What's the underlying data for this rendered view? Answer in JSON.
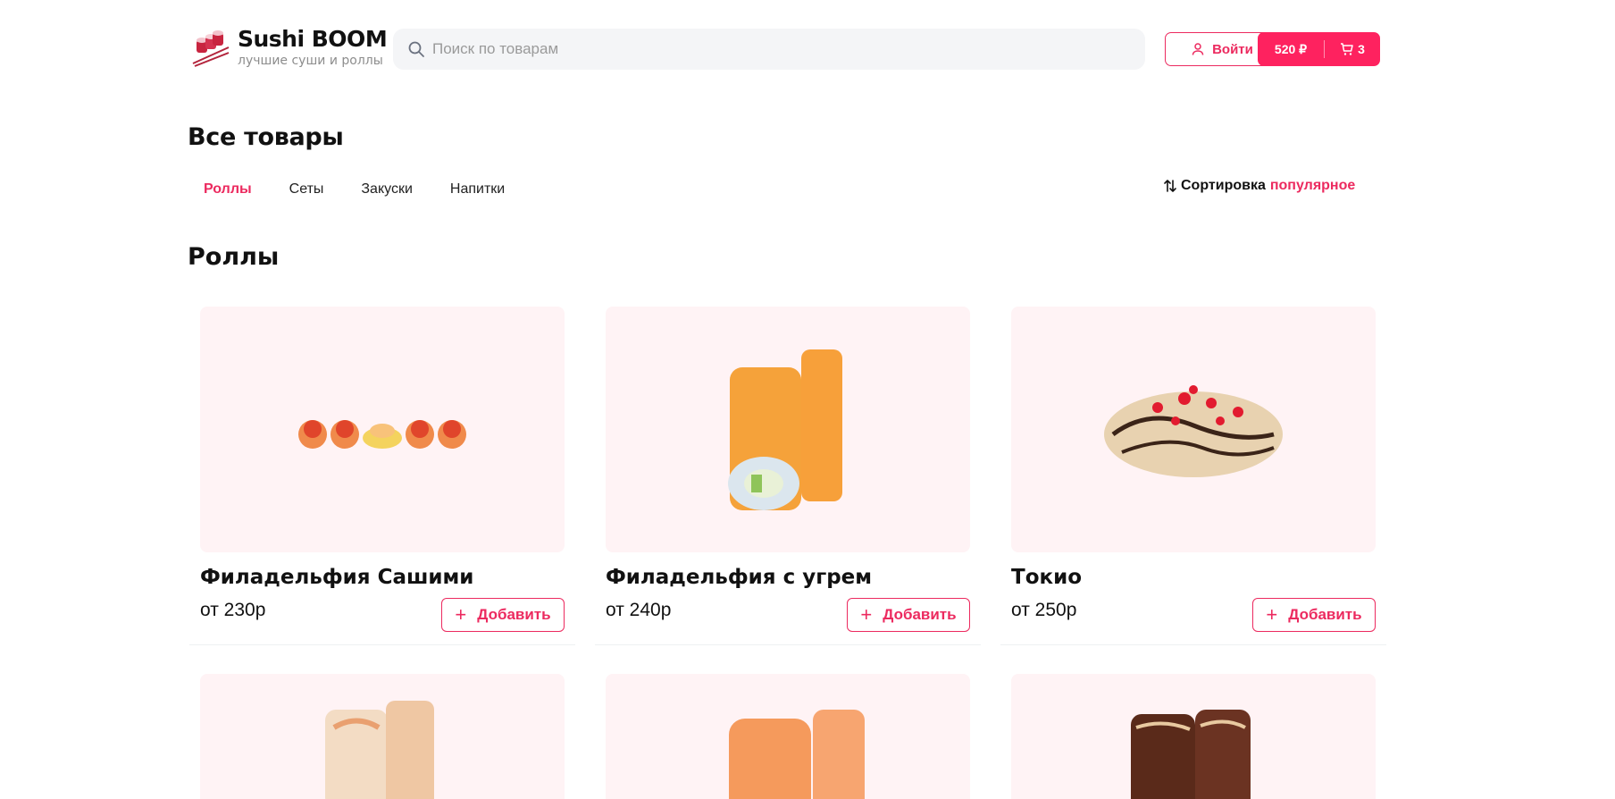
{
  "header": {
    "brand": "Sushi BOOM",
    "tagline": "лучшие суши и роллы",
    "search_placeholder": "Поиск по товарам",
    "login_label": "Войти",
    "cart_sum": "520 ₽",
    "cart_count": "3",
    "accent_color": "#fe225f"
  },
  "main": {
    "title": "Все товары",
    "categories": [
      "Роллы",
      "Сеты",
      "Закуски",
      "Напитки"
    ],
    "active_category": "Роллы",
    "sort_label": "Сортировка",
    "sort_value": "популярное",
    "section_title": "Роллы"
  },
  "products": [
    {
      "name": "Филадельфия Сашими",
      "price": "от 230р",
      "add_label": "Добавить",
      "image": "sashimi-roll-set"
    },
    {
      "name": "Филадельфия с угрем",
      "price": "от 240р",
      "add_label": "Добавить",
      "image": "salmon-roll"
    },
    {
      "name": "Токио",
      "price": "от 250р",
      "add_label": "Добавить",
      "image": "baked-roll-sauce"
    }
  ],
  "products_row2": [
    {
      "image": "creamy-salmon-roll"
    },
    {
      "image": "salmon-roll-plain"
    },
    {
      "image": "eel-sesame-roll"
    }
  ]
}
